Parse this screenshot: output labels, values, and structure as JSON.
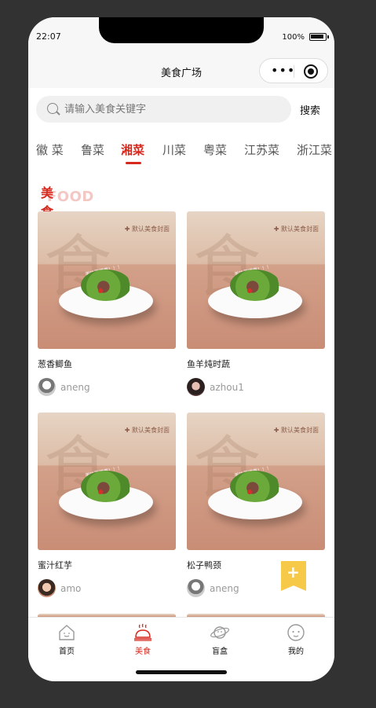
{
  "status": {
    "time": "22:07",
    "battery": "100%"
  },
  "navbar": {
    "title": "美食广场"
  },
  "search": {
    "placeholder": "请输入美食关键字",
    "button": "搜索"
  },
  "tabs": [
    {
      "label": "徽 菜",
      "active": false
    },
    {
      "label": "鲁菜",
      "active": false
    },
    {
      "label": "湘菜",
      "active": true
    },
    {
      "label": "川菜",
      "active": false
    },
    {
      "label": "粤菜",
      "active": false
    },
    {
      "label": "江苏菜",
      "active": false
    },
    {
      "label": "浙江菜",
      "active": false
    }
  ],
  "section": {
    "title": "美食",
    "subtitle": "FOOD"
  },
  "cover": {
    "char": "食",
    "tag": "默认美食封面",
    "slogan": "美味更健康！！！"
  },
  "cards": [
    {
      "name": "葱香鲫鱼",
      "user": "aneng"
    },
    {
      "name": "鱼羊炖时蔬",
      "user": "azhou1"
    },
    {
      "name": "蜜汁红芋",
      "user": "amo"
    },
    {
      "name": "松子鸭颈",
      "user": "aneng"
    }
  ],
  "fab": {
    "icon": "+"
  },
  "tabbar": [
    {
      "label": "首页",
      "icon": "home-icon",
      "active": false
    },
    {
      "label": "美食",
      "icon": "cloche-icon",
      "active": true
    },
    {
      "label": "盲盒",
      "icon": "planet-icon",
      "active": false
    },
    {
      "label": "我的",
      "icon": "smiley-icon",
      "active": false
    }
  ],
  "colors": {
    "accent": "#d6281d",
    "fab": "#f7c948",
    "background": "#323232"
  }
}
